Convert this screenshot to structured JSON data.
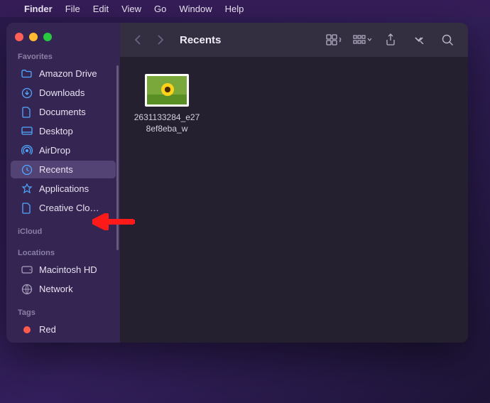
{
  "menubar": {
    "appname": "Finder",
    "items": [
      "File",
      "Edit",
      "View",
      "Go",
      "Window",
      "Help"
    ]
  },
  "window": {
    "title": "Recents"
  },
  "sidebar": {
    "sections": [
      {
        "head": "Favorites",
        "items": [
          {
            "icon": "folder",
            "label": "Amazon Drive",
            "selected": false
          },
          {
            "icon": "download",
            "label": "Downloads",
            "selected": false
          },
          {
            "icon": "doc",
            "label": "Documents",
            "selected": false
          },
          {
            "icon": "desktop",
            "label": "Desktop",
            "selected": false
          },
          {
            "icon": "airdrop",
            "label": "AirDrop",
            "selected": false
          },
          {
            "icon": "clock",
            "label": "Recents",
            "selected": true
          },
          {
            "icon": "apps",
            "label": "Applications",
            "selected": false
          },
          {
            "icon": "file",
            "label": "Creative Clo…",
            "selected": false
          }
        ]
      },
      {
        "head": "iCloud",
        "items": []
      },
      {
        "head": "Locations",
        "items": [
          {
            "icon": "hdd",
            "label": "Macintosh HD",
            "selected": false
          },
          {
            "icon": "globe",
            "label": "Network",
            "selected": false
          }
        ]
      },
      {
        "head": "Tags",
        "items": [
          {
            "icon": "dot-red",
            "label": "Red",
            "selected": false
          }
        ]
      }
    ]
  },
  "files": [
    {
      "name_line1": "2631133284_e27",
      "name_line2": "8ef8eba_w"
    }
  ],
  "annotation": {
    "hint": "red arrow pointing to Applications"
  }
}
